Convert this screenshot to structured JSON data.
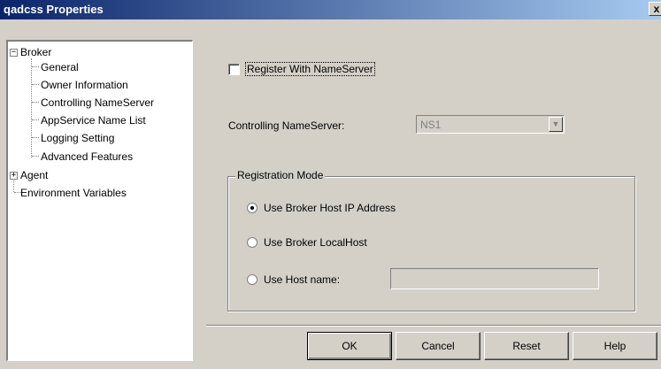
{
  "window": {
    "title": "qadcss Properties",
    "close_label": "x"
  },
  "tree": {
    "broker": {
      "label": "Broker",
      "expander": "−"
    },
    "broker_children": [
      "General",
      "Owner Information",
      "Controlling NameServer",
      "AppService Name List",
      "Logging Setting",
      "Advanced Features"
    ],
    "agent": {
      "label": "Agent",
      "expander": "+"
    },
    "env": {
      "label": "Environment Variables"
    }
  },
  "form": {
    "register_label": "Register With NameServer",
    "register_checked": false,
    "controlling_label": "Controlling NameServer:",
    "controlling_value": "NS1",
    "registration_mode": {
      "title": "Registration Mode",
      "options": [
        {
          "label": "Use Broker Host IP Address",
          "checked": true
        },
        {
          "label": "Use Broker LocalHost",
          "checked": false
        },
        {
          "label": "Use Host name:",
          "checked": false
        }
      ],
      "host_name_value": ""
    }
  },
  "buttons": {
    "ok": "OK",
    "cancel": "Cancel",
    "reset": "Reset",
    "help": "Help"
  }
}
